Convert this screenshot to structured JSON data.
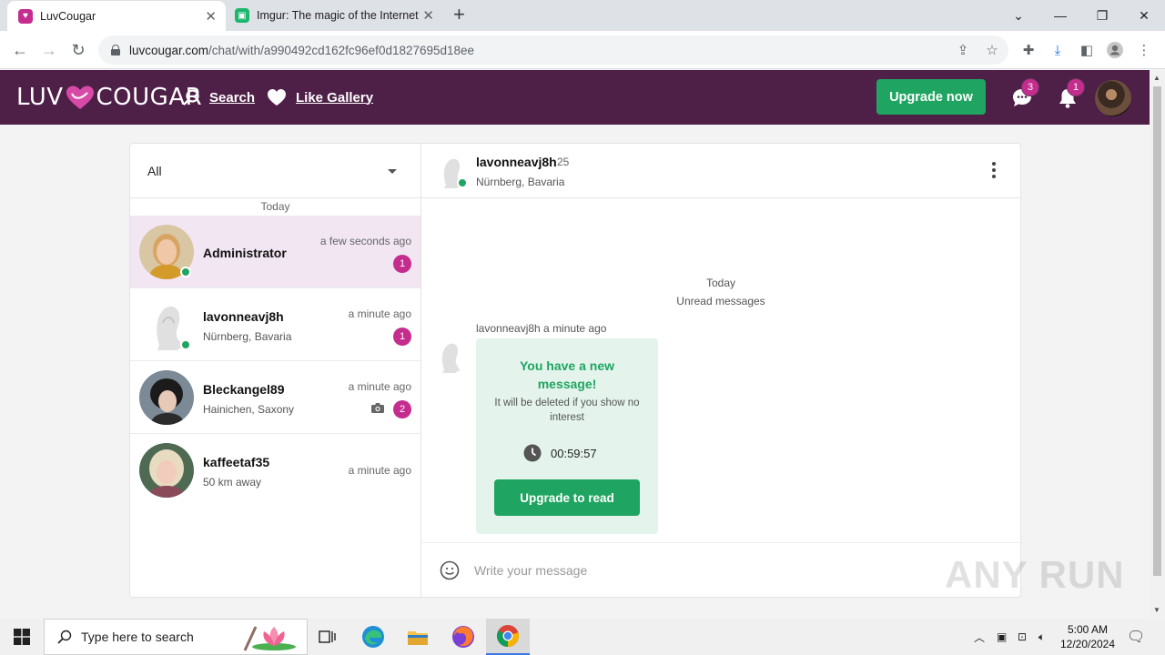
{
  "browser": {
    "tabs": [
      {
        "title": "LuvCougar",
        "active": true
      },
      {
        "title": "Imgur: The magic of the Internet",
        "active": false
      }
    ],
    "url_host": "luvcougar.com",
    "url_path": "/chat/with/a990492cd162fc96ef0d1827695d18ee"
  },
  "site": {
    "logo_left": "LUV",
    "logo_right": "COUGAR",
    "nav": {
      "search": "Search",
      "like_gallery": "Like Gallery"
    },
    "upgrade_label": "Upgrade now",
    "messages_badge": "3",
    "notifications_badge": "1",
    "brand_color": "#4e1f47",
    "accent_color": "#1fa561",
    "badge_color": "#c42d8e"
  },
  "sidebar": {
    "filter_value": "All",
    "day_separator": "Today",
    "conversations": [
      {
        "name": "Administrator",
        "subtitle": "",
        "time": "a few seconds ago",
        "unread": "1"
      },
      {
        "name": "lavonneavj8h",
        "subtitle": "Nürnberg, Bavaria",
        "time": "a minute ago",
        "unread": "1"
      },
      {
        "name": "Bleckangel89",
        "subtitle": "Hainichen, Saxony",
        "time": "a minute ago",
        "unread": "2"
      },
      {
        "name": "kaffeetaf35",
        "subtitle": "50 km away",
        "time": "a minute ago",
        "unread": ""
      }
    ]
  },
  "chat": {
    "name": "lavonneavj8h",
    "age": "25",
    "location": "Nürnberg, Bavaria",
    "day_label": "Today",
    "unread_label": "Unread messages",
    "message_meta": "lavonneavj8h a minute ago",
    "bubble_title": "You have a new message!",
    "bubble_desc": "It will be deleted if you show no interest",
    "countdown": "00:59:57",
    "read_button": "Upgrade to read",
    "composer_placeholder": "Write your message"
  },
  "watermark": "ANY RUN",
  "taskbar": {
    "search_placeholder": "Type here to search",
    "time": "5:00 AM",
    "date": "12/20/2024"
  }
}
